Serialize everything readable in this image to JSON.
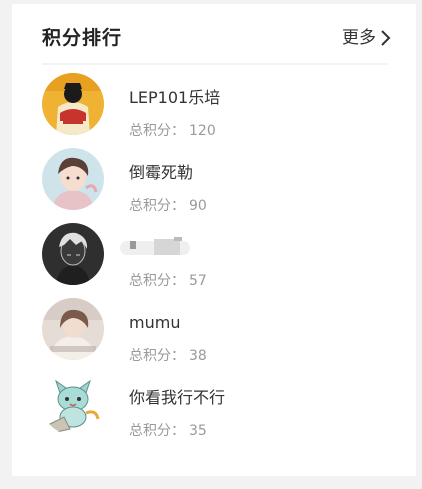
{
  "panel": {
    "title": "积分排行",
    "more_label": "更多"
  },
  "score_label": "总积分：",
  "users": [
    {
      "name": "LEP101乐培",
      "score": "120",
      "avatar": "avatar-china-shirt"
    },
    {
      "name": "倒霉死勒",
      "score": "90",
      "avatar": "avatar-anime-boy"
    },
    {
      "name": "",
      "score": "57",
      "avatar": "avatar-dark-sketch"
    },
    {
      "name": "mumu",
      "score": "38",
      "avatar": "avatar-girl-photo"
    },
    {
      "name": "你看我行不行",
      "score": "35",
      "avatar": "avatar-cartoon-cat"
    }
  ],
  "colors": {
    "background": "#f2f2f2",
    "card": "#ffffff",
    "title": "#222222",
    "name": "#333333",
    "score": "#9a9a9a"
  }
}
